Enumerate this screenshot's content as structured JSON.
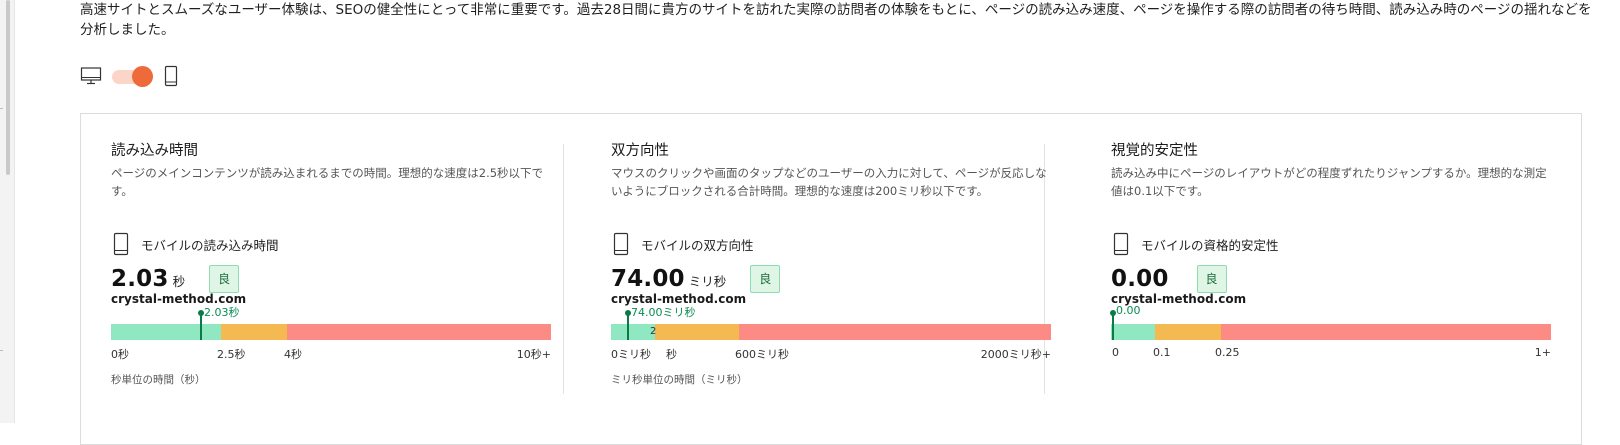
{
  "intro": "高速サイトとスムーズなユーザー体験は、SEOの健全性にとって非常に重要です。過去28日間に貴方のサイトを訪れた実際の訪問者の体験をもとに、ページの読み込み速度、ページを操作する際の訪問者の待ち時間、読み込み時のページの揺れなどを分析しました。",
  "device_toggle": {
    "state": "mobile",
    "icons": [
      "desktop-icon",
      "mobile-icon"
    ]
  },
  "colors": {
    "good": "#8fe8c2",
    "ok": "#f5b951",
    "bad": "#fc8b85",
    "marker": "#0a7a49",
    "accent": "#ee6a3a"
  },
  "metrics": [
    {
      "title": "読み込み時間",
      "description": "ページのメインコンテンツが読み込まれるまでの時間。理想的な速度は2.5秒以下です。",
      "mobile_label": "モバイルの読み込み時間",
      "value": "2.03",
      "unit": "秒",
      "rating": "良",
      "site": "crystal-method.com",
      "marker_label": "2.03秒",
      "marker_value": 2.03,
      "ticks": [
        "0秒",
        "2.5秒",
        "4秒",
        "10秒+"
      ],
      "overlap_text": "",
      "unit_note": "秒単位の時間（秒）"
    },
    {
      "title": "双方向性",
      "description": "マウスのクリックや画面のタップなどのユーザーの入力に対して、ページが反応しないようにブロックされる合計時間。理想的な速度は200ミリ秒以下です。",
      "mobile_label": "モバイルの双方向性",
      "value": "74.00",
      "unit": "ミリ秒",
      "rating": "良",
      "site": "crystal-method.com",
      "marker_label": "74.00ミリ秒",
      "marker_value": 74.0,
      "ticks": [
        "0ミリ秒",
        "秒",
        "600ミリ秒",
        "2000ミリ秒+"
      ],
      "overlap_text": "2",
      "unit_note": "ミリ秒単位の時間（ミリ秒）"
    },
    {
      "title": "視覚的安定性",
      "description": "読み込み中にページのレイアウトがどの程度ずれたりジャンプするか。理想的な測定値は0.1以下です。",
      "mobile_label": "モバイルの資格的安定性",
      "value": "0.00",
      "unit": "",
      "rating": "良",
      "site": "crystal-method.com",
      "marker_label": "0.00",
      "marker_value": 0.0,
      "ticks": [
        "0",
        "0.1",
        "0.25",
        "1+"
      ],
      "overlap_text": "",
      "unit_note": ""
    }
  ]
}
